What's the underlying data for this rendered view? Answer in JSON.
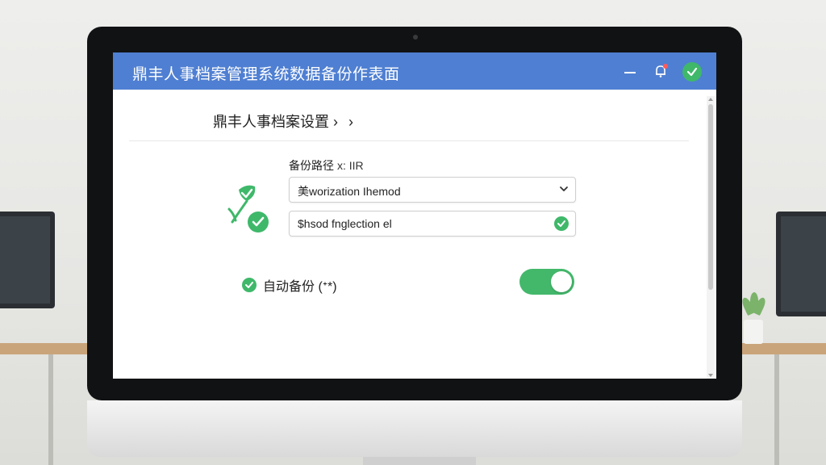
{
  "window": {
    "title": "鼎丰人事档案管理系统数据备份作表面",
    "icons": [
      "minimize-icon",
      "bell-icon",
      "check-icon"
    ]
  },
  "breadcrumb": {
    "label": "鼎丰人事档案设置",
    "separator": "›",
    "chevron": "›"
  },
  "backup_path": {
    "label": "备份路径",
    "label_hint": "x: IIR",
    "select_value": "美worization Ihemod",
    "input_value": "$hsod fnglection el"
  },
  "auto_backup": {
    "label": "自动备份 (ᐩ*)",
    "enabled": true
  },
  "colors": {
    "titlebar": "#4f7fd2",
    "accent_green": "#3fb86a",
    "toggle_green": "#43b86b"
  }
}
